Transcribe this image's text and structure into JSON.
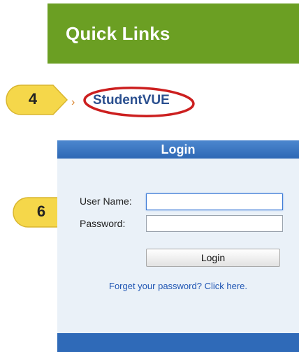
{
  "quick_links": {
    "title": "Quick Links",
    "color": "#6b9f23"
  },
  "callouts": [
    {
      "number": "4"
    },
    {
      "number": "6"
    }
  ],
  "studentvue": {
    "label": "StudentVUE",
    "highlight_color": "#cc1f1f"
  },
  "login": {
    "header": "Login",
    "username_label": "User Name:",
    "username_value": "",
    "password_label": "Password:",
    "password_value": "",
    "button_label": "Login",
    "forgot_link": "Forget your password? Click here."
  },
  "colors": {
    "login_header": "#3a74c2",
    "panel_bg": "#eaf1f8",
    "callout_fill": "#f5d74a"
  }
}
